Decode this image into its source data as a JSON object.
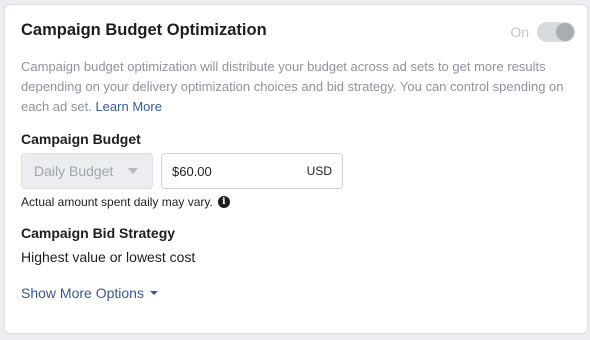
{
  "header": {
    "title": "Campaign Budget Optimization",
    "toggle_label": "On",
    "toggle_state": "on"
  },
  "description": {
    "text": "Campaign budget optimization will distribute your budget across ad sets to get more results depending on your delivery optimization choices and bid strategy. You can control spending on each ad set.",
    "link_label": "Learn More"
  },
  "budget": {
    "label": "Campaign Budget",
    "type_selected": "Daily Budget",
    "amount_value": "$60.00",
    "currency": "USD",
    "note": "Actual amount spent daily may vary."
  },
  "bid_strategy": {
    "label": "Campaign Bid Strategy",
    "value": "Highest value or lowest cost"
  },
  "more_options_label": "Show More Options",
  "colors": {
    "link": "#385898",
    "muted_text": "#8d949e",
    "toggle_track": "#d8dade",
    "toggle_knob": "#a9adb3"
  }
}
